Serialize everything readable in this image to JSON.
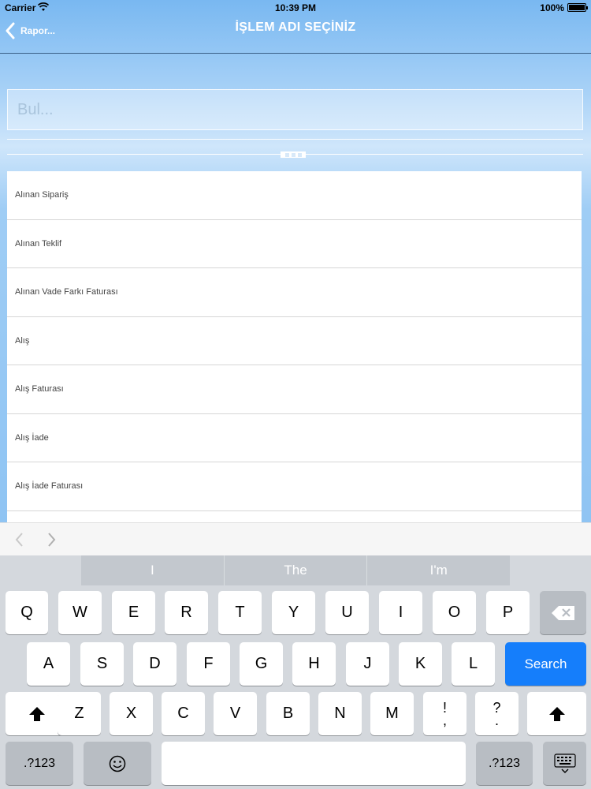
{
  "status": {
    "carrier": "Carrier",
    "time": "10:39 PM",
    "battery": "100%"
  },
  "navbar": {
    "back_label": "Rapor...",
    "title": "İŞLEM ADI SEÇİNİZ"
  },
  "search": {
    "placeholder": "Bul...",
    "value": ""
  },
  "list": {
    "items": [
      "Alınan Sipariş",
      "Alınan Teklif",
      "Alınan Vade Farkı Faturası",
      "Alış",
      "Alış Faturası",
      "Alış İade",
      "Alış İade Faturası",
      ""
    ]
  },
  "keyboard": {
    "suggestions": [
      "I",
      "The",
      "I'm"
    ],
    "row1": [
      "Q",
      "W",
      "E",
      "R",
      "T",
      "Y",
      "U",
      "I",
      "O",
      "P"
    ],
    "row2": [
      "A",
      "S",
      "D",
      "F",
      "G",
      "H",
      "J",
      "K",
      "L"
    ],
    "row3": [
      "Z",
      "X",
      "C",
      "V",
      "B",
      "N",
      "M"
    ],
    "punct1": [
      "!",
      ","
    ],
    "punct2": [
      "?",
      "."
    ],
    "search_label": "Search",
    "numbers_label": ".?123",
    "numbers_label_right": ".?123"
  },
  "icons": {
    "wifi": "wifi-icon",
    "battery": "battery-icon",
    "back": "chevron-left-icon",
    "prev": "chevron-left-icon",
    "next": "chevron-right-icon",
    "backspace": "backspace-icon",
    "shift": "shift-icon",
    "emoji": "emoji-icon",
    "dismiss_keyboard": "keyboard-dismiss-icon"
  },
  "colors": {
    "accent": "#157efb",
    "nav_background": "#79b8f1"
  }
}
